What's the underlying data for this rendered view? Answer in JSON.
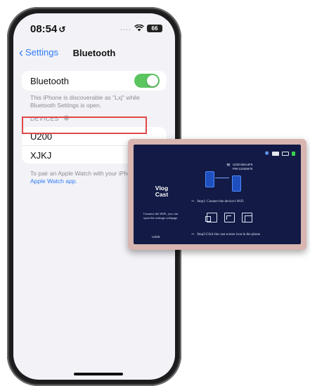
{
  "status_bar": {
    "time": "08:54",
    "time_glyph": "↺",
    "dots": "....",
    "battery": "66"
  },
  "navbar": {
    "back_label": "Settings",
    "title": "Bluetooth"
  },
  "bluetooth": {
    "label": "Bluetooth",
    "enabled": true,
    "discover_note": "This iPhone is discoverable as \"Lxj\" while Bluetooth Settings is open."
  },
  "devices": {
    "header": "DEVICES",
    "items": [
      {
        "name": "U200"
      },
      {
        "name": "XJKJ"
      }
    ]
  },
  "watch_note": {
    "text": "To pair an Apple Watch with your iPhone, go to the",
    "link": "Apple Watch app."
  },
  "cast_screen": {
    "wifi_line1": "U200-B5A4F9",
    "wifi_line2": "PW:12345678",
    "title_line1": "Vlog",
    "title_line2": "Cast",
    "connect_text": "Connect the WiFi, you can open the settings webpage",
    "model": "U200",
    "step1": "Step1: Connect the device's WiFi",
    "step2": "Step2:Click the cast screen icon in the phone",
    "arrow": "⇒"
  },
  "colors": {
    "accent_blue": "#2f7cf6",
    "toggle_green": "#5bc560",
    "highlight_red": "#e0484a",
    "cast_bg": "#121a45"
  }
}
